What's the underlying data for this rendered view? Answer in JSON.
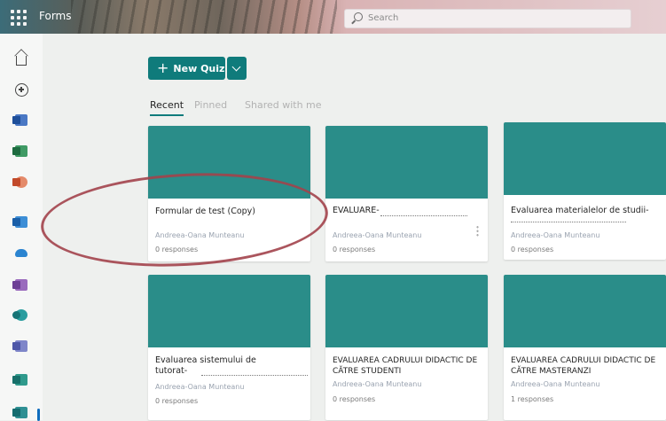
{
  "header": {
    "app_name": "Forms",
    "search_placeholder": "Search"
  },
  "rail": {
    "items": [
      "home-icon",
      "create-icon",
      "word-icon",
      "excel-icon",
      "powerpoint-icon",
      "outlook-icon",
      "onedrive-icon",
      "onenote-icon",
      "sharepoint-icon",
      "teams-icon",
      "sway-icon",
      "forms-icon"
    ]
  },
  "toolbar": {
    "new_quiz_label": "New Quiz"
  },
  "tabs": [
    {
      "label": "Recent",
      "active": true
    },
    {
      "label": "Pinned",
      "active": false
    },
    {
      "label": "Shared with me",
      "active": false
    }
  ],
  "cards": [
    {
      "title": "Formular de test (Copy)",
      "author": "Andreea-Oana Munteanu",
      "responses": "0 responses"
    },
    {
      "title": "EVALUARE-",
      "author": "Andreea-Oana Munteanu",
      "responses": "0 responses"
    },
    {
      "title": "Evaluarea materialelor de studii-",
      "author": "Andreea-Oana Munteanu",
      "responses": "0 responses"
    },
    {
      "title": "Evaluarea sistemului de tutorat-",
      "author": "Andreea-Oana Munteanu",
      "responses": "0 responses"
    },
    {
      "title": "EVALUAREA CADRULUI DIDACTIC DE CĂTRE STUDENTI",
      "author": "Andreea-Oana Munteanu",
      "responses": "0 responses"
    },
    {
      "title": "EVALUAREA CADRULUI DIDACTIC DE CĂTRE MASTERANZI",
      "author": "Andreea-Oana Munteanu",
      "responses": "1 responses"
    }
  ],
  "colors": {
    "accent": "#0f7b7b",
    "thumbnail": "#2a8d89",
    "annotation": "#a2424b"
  }
}
